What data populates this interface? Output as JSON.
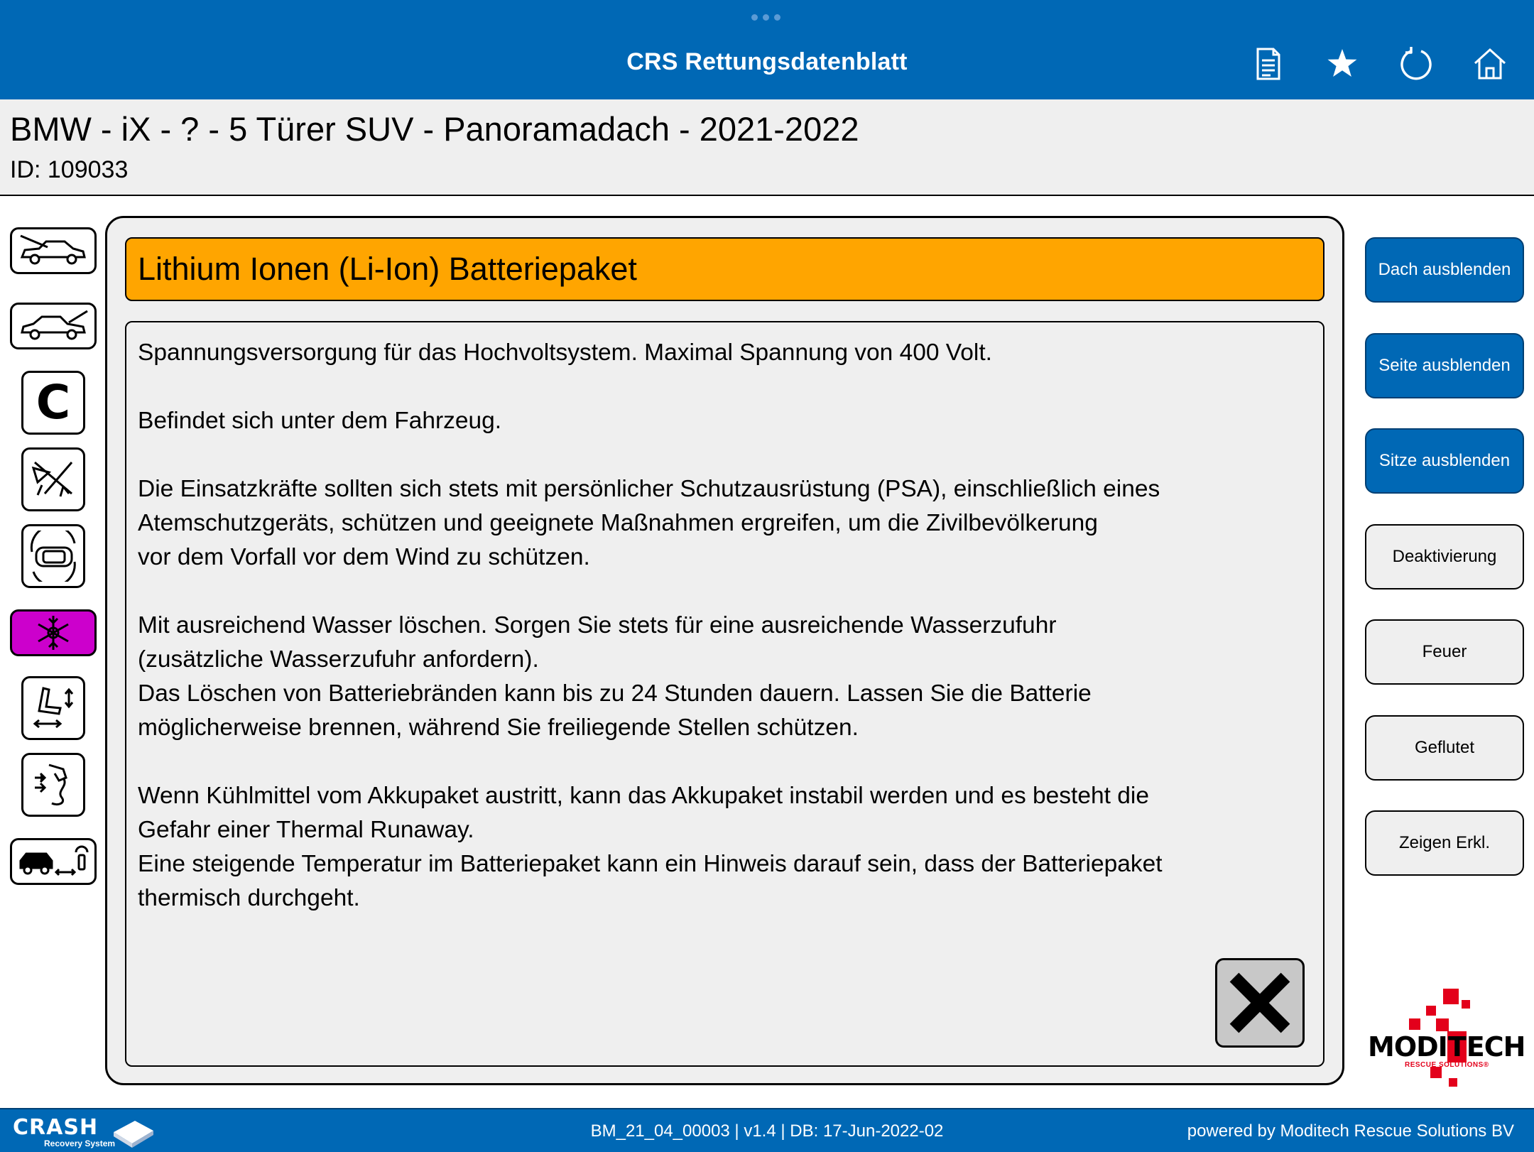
{
  "app": {
    "title": "CRS Rettungsdatenblatt"
  },
  "toolbar": {
    "icons": [
      "document-icon",
      "star-icon",
      "refresh-icon",
      "home-icon"
    ]
  },
  "vehicle": {
    "title": "BMW - iX - ? - 5 Türer SUV - Panoramadach - 2021-2022",
    "id": "ID: 109033"
  },
  "left_nav": {
    "icons": [
      "car-front-hood-icon",
      "car-rear-trunk-icon",
      "c-letter-icon",
      "airbag-icon",
      "car-topview-icon",
      "snowflake-icon",
      "seat-adjust-icon",
      "fuel-icon",
      "car-remote-key-icon"
    ],
    "active_color": "#cc00cc"
  },
  "section": {
    "title": "Lithium Ionen (Li-Ion) Batteriepaket",
    "header_color": "#ffa500",
    "paragraphs": [
      "Spannungsversorgung für das Hochvoltsystem. Maximal Spannung von 400 Volt.",
      "Befindet sich unter dem Fahrzeug.",
      "Die Einsatzkräfte sollten sich stets mit persönlicher Schutzausrüstung (PSA), einschließlich eines\nAtemschutzgeräts, schützen und geeignete Maßnahmen ergreifen, um die Zivilbevölkerung\nvor dem Vorfall vor dem Wind zu schützen.",
      "Mit ausreichend Wasser löschen. Sorgen Sie stets für eine ausreichende Wasserzufuhr\n(zusätzliche Wasserzufuhr anfordern).\nDas Löschen von Batteriebränden kann bis zu 24 Stunden dauern. Lassen Sie die Batterie\nmöglicherweise brennen, während Sie freiliegende Stellen schützen.",
      "Wenn Kühlmittel vom Akkupaket austritt, kann das Akkupaket instabil werden und es besteht die\nGefahr einer Thermal Runaway.\nEine steigende Temperatur im Batteriepaket kann ein Hinweis darauf sein, dass der Batteriepaket\nthermisch durchgeht."
    ]
  },
  "side_buttons": [
    {
      "label": "Dach ausblenden",
      "style": "primary"
    },
    {
      "label": "Seite ausblenden",
      "style": "primary"
    },
    {
      "label": "Sitze ausblenden",
      "style": "primary"
    },
    {
      "label": "Deaktivierung",
      "style": "secondary"
    },
    {
      "label": "Feuer",
      "style": "secondary"
    },
    {
      "label": "Geflutet",
      "style": "secondary"
    },
    {
      "label": "Zeigen Erkl.",
      "style": "secondary"
    }
  ],
  "logo": {
    "word_pre": "MODI",
    "word_hl": "T",
    "word_post": "ECH",
    "tagline": "RESCUE SOLUTIONS®"
  },
  "footer": {
    "brand": "CRASH",
    "brand_sub": "Recovery System",
    "version": "BM_21_04_00003 | v1.4 | DB: 17-Jun-2022-02",
    "powered": "powered by Moditech Rescue Solutions BV"
  },
  "colors": {
    "brand_blue": "#0068b5",
    "panel_bg": "#efefef",
    "logo_red": "#e3001b"
  }
}
